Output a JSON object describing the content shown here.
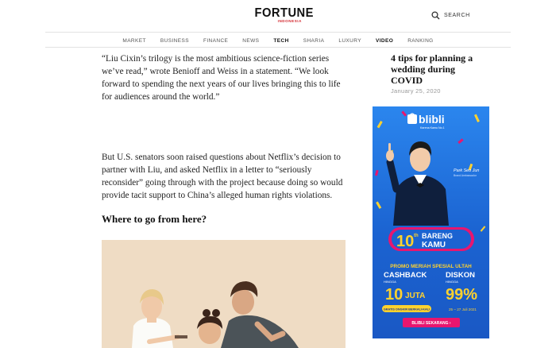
{
  "header": {
    "logo_main": "FORTUNE",
    "logo_sub": "INDONESIA",
    "search_label": "SEARCH"
  },
  "nav": {
    "items": [
      {
        "label": "MARKET",
        "bold": false
      },
      {
        "label": "BUSINESS",
        "bold": false
      },
      {
        "label": "FINANCE",
        "bold": false
      },
      {
        "label": "NEWS",
        "bold": false
      },
      {
        "label": "TECH",
        "bold": true
      },
      {
        "label": "SHARIA",
        "bold": false
      },
      {
        "label": "LUXURY",
        "bold": false
      },
      {
        "label": "VIDEO",
        "bold": true
      },
      {
        "label": "RANKING",
        "bold": false
      }
    ]
  },
  "article": {
    "paragraph_1": "“Liu Cixin’s trilogy is the most ambitious science-fiction series we’ve read,” wrote Benioff and Weiss in a statement. “We look forward to spending the next years of our lives bringing this to life for audiences around the world.”",
    "paragraph_2": "But U.S. senators soon raised questions about Netflix’s decision to partner with Liu, and asked Netflix in a letter to “seriously reconsider” going through with the project because doing so would provide tacit support to China’s alleged human rights violations.",
    "heading": "Where to go from here?"
  },
  "sidebar": {
    "related_title": "4 tips for planning a wedding during COVID",
    "related_date": "January 25, 2020"
  },
  "ad": {
    "brand": "blibli",
    "tagline": "Karena Kamu No.1",
    "person_name": "Park Seo Jun",
    "person_caption": "Brand Ambassador",
    "event_number": "10",
    "event_suffix": "th",
    "event_word_1": "BARENG",
    "event_word_2": "KAMU",
    "promo_title": "PROMO MERIAH SPESIAL ULTAH",
    "cashback_label": "CASHBACK",
    "cashback_hingga": "HINGGA",
    "cashback_value": "10",
    "cashback_unit": "JUTA",
    "diskon_label": "DISKON",
    "diskon_hingga": "HINGGA",
    "diskon_value": "99%",
    "shipping_text": "GRATIS ONGKIR BERKALI-KALI",
    "date_text": "25 – 27 Juli 2021",
    "cta": "BLIBLI SEKARANG ›",
    "colors": {
      "bg": "#1e6fd9",
      "yellow": "#ffd22e",
      "pink": "#e8166f"
    }
  }
}
